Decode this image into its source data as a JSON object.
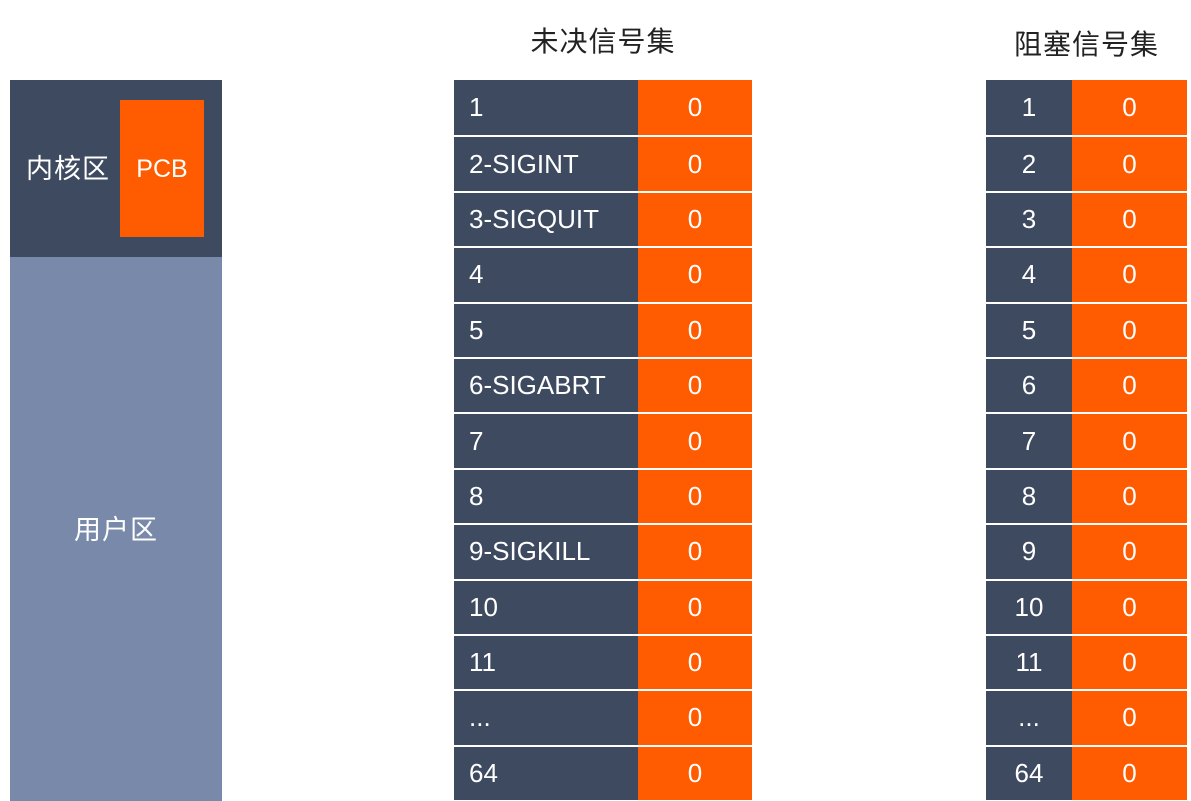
{
  "memory": {
    "kernel_label": "内核区",
    "pcb_label": "PCB",
    "user_label": "用户区"
  },
  "pending_set": {
    "title": "未决信号集",
    "rows": [
      {
        "signal": "1",
        "bit": "0"
      },
      {
        "signal": "2-SIGINT",
        "bit": "0"
      },
      {
        "signal": "3-SIGQUIT",
        "bit": "0"
      },
      {
        "signal": "4",
        "bit": "0"
      },
      {
        "signal": "5",
        "bit": "0"
      },
      {
        "signal": "6-SIGABRT",
        "bit": "0"
      },
      {
        "signal": "7",
        "bit": "0"
      },
      {
        "signal": "8",
        "bit": "0"
      },
      {
        "signal": "9-SIGKILL",
        "bit": "0"
      },
      {
        "signal": "10",
        "bit": "0"
      },
      {
        "signal": "11",
        "bit": "0"
      },
      {
        "signal": "...",
        "bit": "0"
      },
      {
        "signal": "64",
        "bit": "0"
      }
    ]
  },
  "blocked_set": {
    "title": "阻塞信号集",
    "rows": [
      {
        "signal": "1",
        "bit": "0"
      },
      {
        "signal": "2",
        "bit": "0"
      },
      {
        "signal": "3",
        "bit": "0"
      },
      {
        "signal": "4",
        "bit": "0"
      },
      {
        "signal": "5",
        "bit": "0"
      },
      {
        "signal": "6",
        "bit": "0"
      },
      {
        "signal": "7",
        "bit": "0"
      },
      {
        "signal": "8",
        "bit": "0"
      },
      {
        "signal": "9",
        "bit": "0"
      },
      {
        "signal": "10",
        "bit": "0"
      },
      {
        "signal": "11",
        "bit": "0"
      },
      {
        "signal": "...",
        "bit": "0"
      },
      {
        "signal": "64",
        "bit": "0"
      }
    ]
  },
  "colors": {
    "dark_cell": "#3e4a60",
    "bit_cell": "#ff5b00",
    "user_area": "#7889aa"
  }
}
